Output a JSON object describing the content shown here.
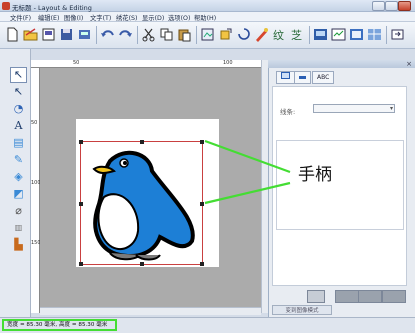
{
  "window": {
    "title": "无标题 - Layout & Editing",
    "controls": [
      "minimize",
      "maximize",
      "close"
    ]
  },
  "menu": [
    "文件(F)",
    "编辑(E)",
    "图像(I)",
    "文字(T)",
    "绣花(S)",
    "显示(D)",
    "选项(O)",
    "帮助(H)"
  ],
  "toolbar_icons": [
    "new-icon",
    "open-icon",
    "template-icon",
    "save-icon",
    "send-icon",
    "undo-icon",
    "redo-icon",
    "cut-icon",
    "copy-icon",
    "paste-icon",
    "import-icon",
    "rotate-icon",
    "sew-order-icon",
    "text-attribute-icon",
    "pattern-icon",
    "stitch-icon",
    "layout-icon",
    "preview-icon",
    "properties-icon"
  ],
  "tools": [
    "select-tool",
    "point-edit-tool",
    "zoom-tool",
    "text-tool",
    "shape-tool",
    "outline-tool",
    "area-tool",
    "brush-tool",
    "eraser-tool",
    "stitch-tool",
    "pen-tool"
  ],
  "ruler": {
    "h_labels": [
      "50",
      "100"
    ],
    "v_labels": [
      "50",
      "100",
      "150"
    ]
  },
  "side_panel": {
    "tabs": [
      "",
      "",
      "ABC"
    ],
    "outline_label": "线条:",
    "outline_value": "",
    "convert_button": "变到图像模式"
  },
  "annotation": {
    "label": "手柄",
    "color": "#44dd33"
  },
  "status": {
    "size_text": "宽度 = 85.30 毫米, 高度 = 85.30 毫米"
  },
  "colors": {
    "accent_green": "#44dd33",
    "penguin_blue": "#1d7fd6",
    "selection_red": "#c94040"
  }
}
